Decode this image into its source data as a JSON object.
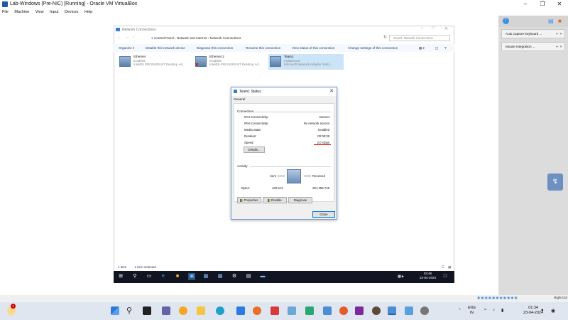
{
  "vbox": {
    "title": "Lab-Windows (Pre-NIC) [Running] - Oracle VM VirtualBox",
    "menu": [
      "File",
      "Machine",
      "View",
      "Input",
      "Devices",
      "Help"
    ],
    "status_right": "Right Ctrl"
  },
  "explorer": {
    "title": "Network Connections",
    "breadcrumb": [
      "Control Panel",
      "Network and Internet",
      "Network Connections"
    ],
    "search_placeholder": "Search Network Connections",
    "commands": [
      "Organize ▾",
      "Disable this network device",
      "Diagnose this connection",
      "Rename this connection",
      "View status of this connection",
      "Change settings of this connection"
    ],
    "adapters": [
      {
        "name": "Ethernet",
        "status": "Enabled",
        "device": "Intel(R) PRO/1000 MT Desktop Ad..."
      },
      {
        "name": "Ethernet 2",
        "status": "Enabled",
        "device": "Intel(R) PRO/1000 MT Desktop Ad..."
      },
      {
        "name": "Team1",
        "status": "mylab.local",
        "device": "Microsoft Network Adapter Multi..."
      }
    ],
    "status_bar": {
      "items": "1 item",
      "selected": "1 item selected"
    }
  },
  "dialog": {
    "title": "Team1 Status",
    "tab": "General",
    "connection_label": "Connection",
    "rows": [
      {
        "label": "IPv4 Connectivity:",
        "value": "Internet"
      },
      {
        "label": "IPv6 Connectivity:",
        "value": "No network access"
      },
      {
        "label": "Media State:",
        "value": "Enabled"
      },
      {
        "label": "Duration:",
        "value": "00:08:39"
      },
      {
        "label": "Speed:",
        "value": "2.0 Gbps"
      }
    ],
    "details_button": "Details...",
    "activity_label": "Activity",
    "sent_label": "Sent",
    "received_label": "Received",
    "bytes_label": "Bytes:",
    "bytes_sent": "420,513",
    "bytes_received": "201,399,749",
    "properties_button": "Properties",
    "disable_button": "Disable",
    "diagnose_button": "Diagnose",
    "close_button": "Close"
  },
  "guest_taskbar": {
    "time": "03:46",
    "date": "22-04-2024"
  },
  "right_panel": {
    "items": [
      "Auto capture keyboard ...",
      "Mouse integration ..."
    ]
  },
  "host_taskbar": {
    "lang_top": "ENG",
    "lang_bottom": "IN",
    "time": "01:34",
    "date": "23-04-2024",
    "notification_count": "1"
  }
}
